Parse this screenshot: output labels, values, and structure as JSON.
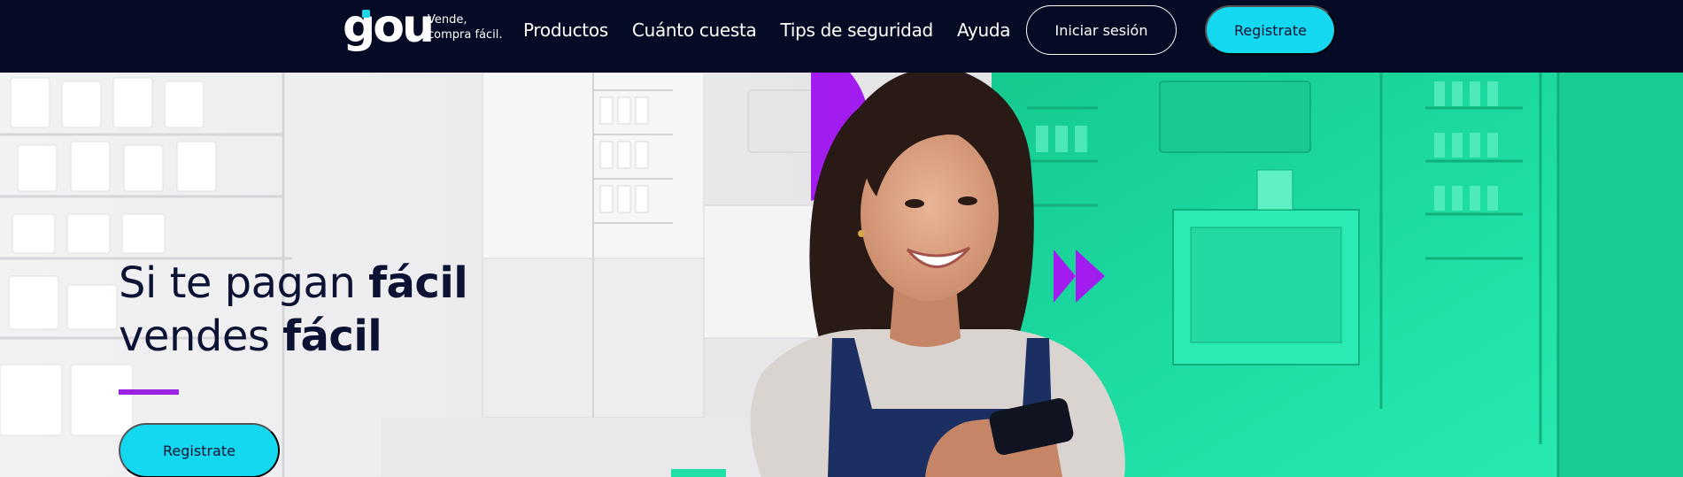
{
  "brand": {
    "name": "gou",
    "tagline_line1": "Vende,",
    "tagline_line2": "compra fácil."
  },
  "nav": {
    "items": [
      {
        "label": "Productos"
      },
      {
        "label": "Cuánto cuesta"
      },
      {
        "label": "Tips de seguridad"
      },
      {
        "label": "Ayuda"
      }
    ],
    "login_label": "Iniciar sesión",
    "register_label": "Registrate"
  },
  "hero": {
    "headline_line1_normal": "Si te pagan ",
    "headline_line1_bold": "fácil",
    "headline_line2_normal": "vendes ",
    "headline_line2_bold": "fácil",
    "cta_label": "Registrate"
  },
  "colors": {
    "nav_bg": "#050b24",
    "accent_cyan": "#14d8f0",
    "accent_purple": "#9b22e3",
    "accent_green": "#1fe0a6",
    "text_dark": "#0c1233"
  },
  "icons": [
    "fast-forward-icon",
    "half-circle-decoration"
  ]
}
